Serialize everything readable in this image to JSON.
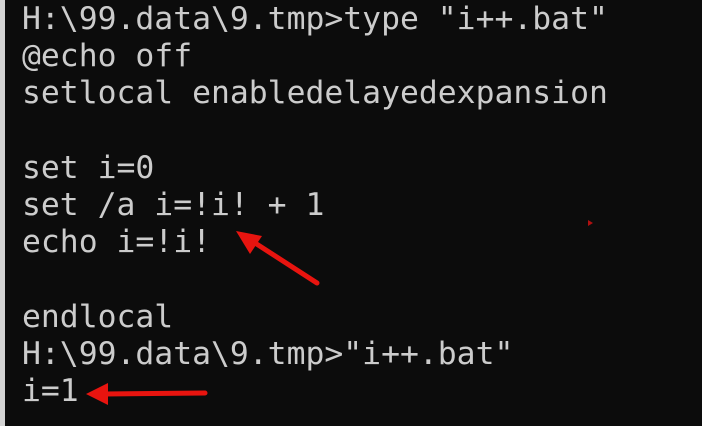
{
  "terminal": {
    "lines": [
      "H:\\99.data\\9.tmp>type \"i++.bat\"",
      "@echo off",
      "setlocal enabledelayedexpansion",
      "",
      "set i=0",
      "set /a i=!i! + 1",
      "echo i=!i!",
      "",
      "endlocal",
      "H:\\99.data\\9.tmp>\"i++.bat\"",
      "i=1"
    ]
  },
  "colors": {
    "background": "#0c0c0c",
    "text": "#cccccc",
    "annotation": "#e8140f"
  }
}
